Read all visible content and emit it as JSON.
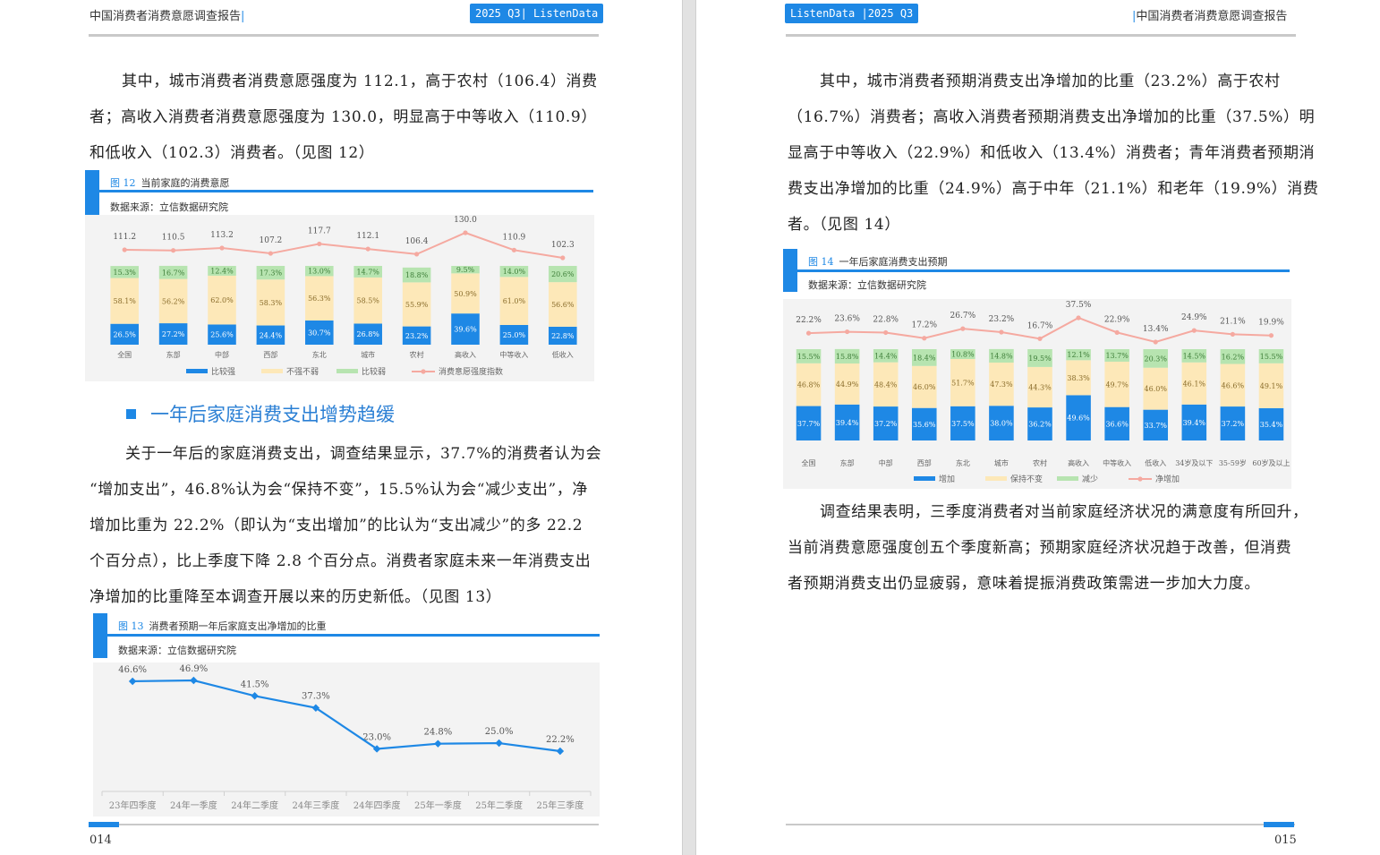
{
  "left": {
    "header": {
      "title": "中国消费者消费意愿调查报告",
      "badge": "2025 Q3| ListenData"
    },
    "para1": [
      "其中，城市消费者消费意愿强度为 112.1，高于农村（106.4）消费",
      "者；高收入消费者消费意愿强度为 130.0，明显高于中等收入（110.9）",
      "和低收入（102.3）消费者。（见图 12）"
    ],
    "fig12": {
      "num": "图 12",
      "title": "当前家庭的消费意愿",
      "source": "数据来源：立信数据研究院"
    },
    "section_heading": "一年后家庭消费支出增势趋缓",
    "para2": [
      "关于一年后的家庭消费支出，调查结果显示，37.7%的消费者认为会",
      "“增加支出”，46.8%认为会“保持不变”，15.5%认为会“减少支出”，净",
      "增加比重为 22.2%（即认为“支出增加”的比认为“支出减少”的多 22.2",
      "个百分点），比上季度下降 2.8 个百分点。消费者家庭未来一年消费支出",
      "净增加的比重降至本调查开展以来的历史新低。（见图 13）"
    ],
    "fig13": {
      "num": "图 13",
      "title": "消费者预期一年后家庭支出净增加的比重",
      "source": "数据来源：立信数据研究院"
    },
    "page_number": "014"
  },
  "right": {
    "header": {
      "badge": "ListenData |2025 Q3",
      "title": "中国消费者消费意愿调查报告"
    },
    "para1": [
      "其中，城市消费者预期消费支出净增加的比重（23.2%）高于农村",
      "（16.7%）消费者；高收入消费者预期消费支出净增加的比重（37.5%）明",
      "显高于中等收入（22.9%）和低收入（13.4%）消费者；青年消费者预期消",
      "费支出净增加的比重（24.9%）高于中年（21.1%）和老年（19.9%）消费",
      "者。（见图 14）"
    ],
    "fig14": {
      "num": "图 14",
      "title": "一年后家庭消费支出预期",
      "source": "数据来源：立信数据研究院"
    },
    "para2": [
      "调查结果表明，三季度消费者对当前家庭经济状况的满意度有所回升，",
      "当前消费意愿强度创五个季度新高；预期家庭经济状况趋于改善，但消费",
      "者预期消费支出仍显疲弱，意味着提振消费政策需进一步加大力度。"
    ],
    "page_number": "015"
  },
  "colors": {
    "blue": "#1e88e5",
    "beige": "#fde8b8",
    "green": "#b7e4b0",
    "pink_line": "#f5a9a0"
  },
  "chart_data": [
    {
      "id": "fig12",
      "type": "bar",
      "stacked": true,
      "categories": [
        "全国",
        "东部",
        "中部",
        "西部",
        "东北",
        "城市",
        "农村",
        "高收入",
        "中等收入",
        "低收入"
      ],
      "series": [
        {
          "name": "比较强",
          "values": [
            26.5,
            27.2,
            25.6,
            24.4,
            30.7,
            26.8,
            23.2,
            39.6,
            25.0,
            22.8
          ],
          "labels": [
            "26.5%",
            "27.2%",
            "25.6%",
            "24.4%",
            "30.7%",
            "26.8%",
            "23.2%",
            "39.6%",
            "25.0%",
            "22.8%"
          ]
        },
        {
          "name": "不强不弱",
          "values": [
            58.1,
            56.2,
            62.0,
            58.3,
            56.3,
            58.5,
            55.9,
            50.9,
            61.0,
            56.6
          ],
          "labels": [
            "58.1%",
            "56.2%",
            "62.0%",
            "58.3%",
            "56.3%",
            "58.5%",
            "55.9%",
            "50.9%",
            "61.0%",
            "56.6%"
          ]
        },
        {
          "name": "比较弱",
          "values": [
            15.3,
            16.7,
            12.4,
            17.3,
            13.0,
            14.7,
            18.8,
            9.5,
            14.0,
            20.6
          ],
          "labels": [
            "15.3%",
            "16.7%",
            "12.4%",
            "17.3%",
            "13.0%",
            "14.7%",
            "18.8%",
            "9.5%",
            "14.0%",
            "20.6%"
          ]
        },
        {
          "name": "消费意愿强度指数",
          "type": "line",
          "values": [
            111.2,
            110.5,
            113.2,
            107.2,
            117.7,
            112.1,
            106.4,
            130.0,
            110.9,
            102.3
          ],
          "labels": [
            "111.2",
            "110.5",
            "113.2",
            "107.2",
            "117.7",
            "112.1",
            "106.4",
            "130.0",
            "110.9",
            "102.3"
          ]
        }
      ]
    },
    {
      "id": "fig13",
      "type": "line",
      "categories": [
        "23年四季度",
        "24年一季度",
        "24年二季度",
        "24年三季度",
        "24年四季度",
        "25年一季度",
        "25年二季度",
        "25年三季度"
      ],
      "series": [
        {
          "values": [
            46.6,
            46.9,
            41.5,
            37.3,
            23.0,
            24.8,
            25.0,
            22.2
          ],
          "labels": [
            "46.6%",
            "46.9%",
            "41.5%",
            "37.3%",
            "23.0%",
            "24.8%",
            "25.0%",
            "22.2%"
          ]
        }
      ]
    },
    {
      "id": "fig14",
      "type": "bar",
      "stacked": true,
      "categories": [
        "全国",
        "东部",
        "中部",
        "西部",
        "东北",
        "城市",
        "农村",
        "高收入",
        "中等收入",
        "低收入",
        "34岁及以下",
        "35-59岁",
        "60岁及以上"
      ],
      "series": [
        {
          "name": "增加",
          "values": [
            37.7,
            39.4,
            37.2,
            35.6,
            37.5,
            38.0,
            36.2,
            49.6,
            36.6,
            33.7,
            39.4,
            37.2,
            35.4
          ],
          "labels": [
            "37.7%",
            "39.4%",
            "37.2%",
            "35.6%",
            "37.5%",
            "38.0%",
            "36.2%",
            "49.6%",
            "36.6%",
            "33.7%",
            "39.4%",
            "37.2%",
            "35.4%"
          ]
        },
        {
          "name": "保持不变",
          "values": [
            46.8,
            44.9,
            48.4,
            46.0,
            51.7,
            47.3,
            44.3,
            38.3,
            49.7,
            46.0,
            46.1,
            46.6,
            49.1
          ],
          "labels": [
            "46.8%",
            "44.9%",
            "48.4%",
            "46.0%",
            "51.7%",
            "47.3%",
            "44.3%",
            "38.3%",
            "49.7%",
            "46.0%",
            "46.1%",
            "46.6%",
            "49.1%"
          ]
        },
        {
          "name": "减少",
          "values": [
            15.5,
            15.8,
            14.4,
            18.4,
            10.8,
            14.8,
            19.5,
            12.1,
            13.7,
            20.3,
            14.5,
            16.2,
            15.5
          ],
          "labels": [
            "15.5%",
            "15.8%",
            "14.4%",
            "18.4%",
            "10.8%",
            "14.8%",
            "19.5%",
            "12.1%",
            "13.7%",
            "20.3%",
            "14.5%",
            "16.2%",
            "15.5%"
          ]
        },
        {
          "name": "净增加",
          "type": "line",
          "values": [
            22.2,
            23.6,
            22.8,
            17.2,
            26.7,
            23.2,
            16.7,
            37.5,
            22.9,
            13.4,
            24.9,
            21.1,
            19.9
          ],
          "labels": [
            "22.2%",
            "23.6%",
            "22.8%",
            "17.2%",
            "26.7%",
            "23.2%",
            "16.7%",
            "37.5%",
            "22.9%",
            "13.4%",
            "24.9%",
            "21.1%",
            "19.9%"
          ]
        }
      ]
    }
  ]
}
